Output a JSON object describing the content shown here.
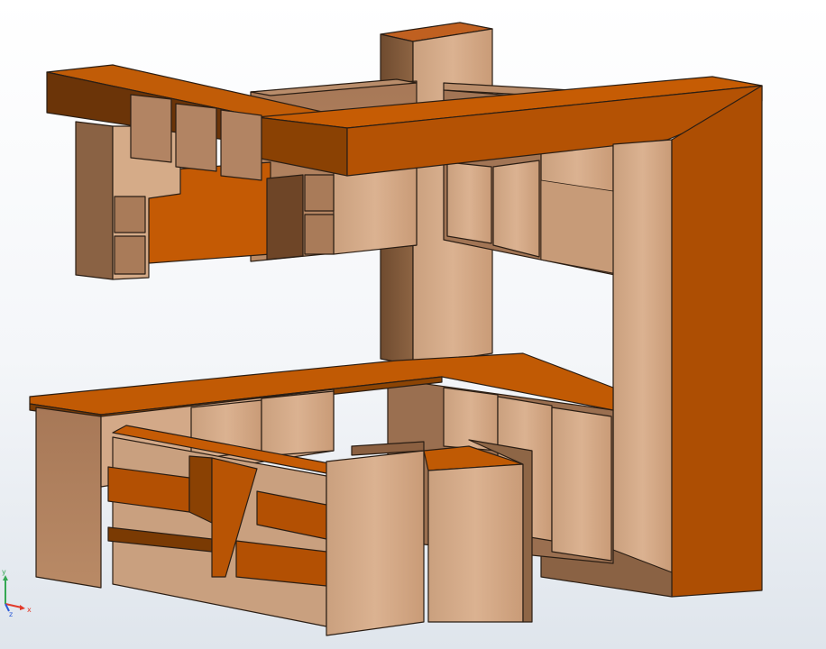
{
  "scene": {
    "subject": "kitchen-cabinet-assembly",
    "colors": {
      "background": "#ffffff",
      "wood_light": "#d6a985",
      "wood_mid": "#b0815c",
      "wood_dark": "#7d5638",
      "wood_shadow": "#5e3d22",
      "orange_top": "#c65c04",
      "orange_face": "#a94c02",
      "orange_dark": "#6a3102",
      "edge": "#2b1e14"
    }
  },
  "triad": {
    "x_axis": {
      "label": "x",
      "color": "#e23a2a"
    },
    "y_axis": {
      "label": "y",
      "color": "#34a853"
    },
    "z_axis": {
      "label": "z",
      "color": "#2c5bd8"
    }
  }
}
